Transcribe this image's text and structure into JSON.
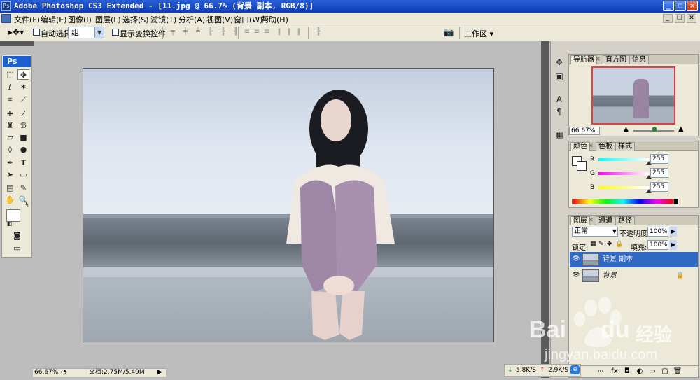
{
  "window": {
    "title": "Adobe Photoshop CS3 Extended - [11.jpg @ 66.7% (背景 副本, RGB/8)]",
    "app_badge": "Ps",
    "buttons": [
      "_",
      "❐",
      "✕"
    ]
  },
  "menu": {
    "items": [
      "文件(F)",
      "编辑(E)",
      "图像(I)",
      "图层(L)",
      "选择(S)",
      "滤镜(T)",
      "分析(A)",
      "视图(V)",
      "窗口(W)",
      "帮助(H)"
    ]
  },
  "options": {
    "auto_select_label": "自动选择:",
    "auto_select_value": "组",
    "show_transform_label": "显示变换控件",
    "workspace_label": "工作区 ▾"
  },
  "toolbox": {
    "logo": "Ps"
  },
  "status": {
    "zoom": "66.67%",
    "doc_info": "文档:2.75M/5.49M"
  },
  "navigator": {
    "tabs": [
      "导航器",
      "直方图",
      "信息"
    ],
    "zoom": "66.67%"
  },
  "color": {
    "tabs": [
      "颜色",
      "色板",
      "样式"
    ],
    "r_label": "R",
    "g_label": "G",
    "b_label": "B",
    "r": "255",
    "g": "255",
    "b": "255"
  },
  "layers": {
    "tabs": [
      "图层",
      "通道",
      "路径"
    ],
    "blend_mode": "正常",
    "opacity_label": "不透明度:",
    "opacity": "100%",
    "lock_label": "锁定:",
    "fill_label": "填充:",
    "fill": "100%",
    "items": [
      {
        "name": "背景 副本",
        "selected": true
      },
      {
        "name": "背景",
        "selected": false,
        "locked": true
      }
    ]
  },
  "network": {
    "down": "5.8K/S",
    "up": "2.9K/S"
  },
  "watermark": {
    "brand_text": "Bai",
    "brand_text2": "du",
    "brand_cn": "经验",
    "url": "jingyan.baidu.com"
  },
  "colors": {
    "title_bar": "#0b3db5",
    "selected_layer": "#316ac5"
  }
}
